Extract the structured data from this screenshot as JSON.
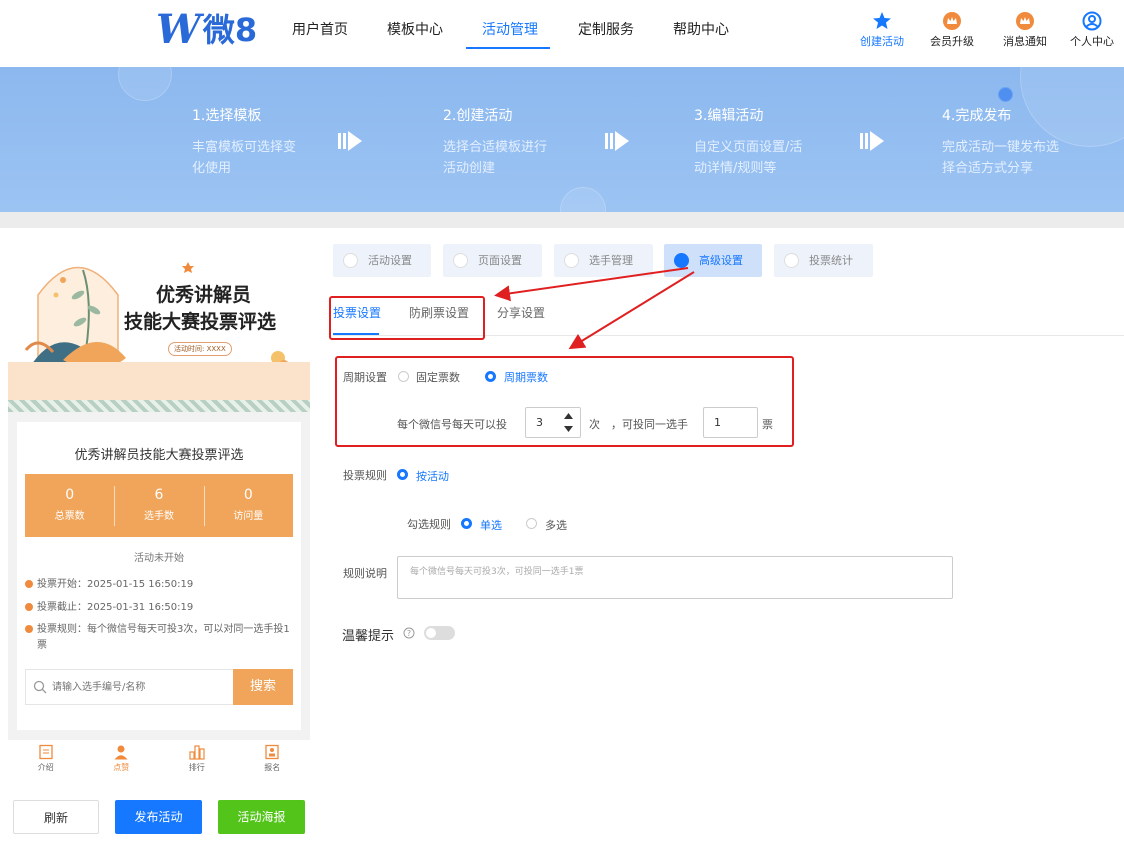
{
  "header": {
    "logo_letter": "W",
    "logo_text": "微8",
    "nav": [
      "用户首页",
      "模板中心",
      "活动管理",
      "定制服务",
      "帮助中心"
    ],
    "active_nav": "活动管理",
    "icons": [
      {
        "label": "创建活动",
        "icon": "star-icon"
      },
      {
        "label": "会员升级",
        "icon": "crown-icon"
      },
      {
        "label": "消息通知",
        "icon": "bell-icon"
      },
      {
        "label": "个人中心",
        "icon": "user-circle-icon"
      }
    ]
  },
  "steps": [
    {
      "title": "1.选择模板",
      "desc": "丰富模板可选择变化使用"
    },
    {
      "title": "2.创建活动",
      "desc": "选择合适模板进行活动创建"
    },
    {
      "title": "3.编辑活动",
      "desc": "自定义页面设置/活动详情/规则等"
    },
    {
      "title": "4.完成发布",
      "desc": "完成活动一键发布选择合适方式分享"
    }
  ],
  "preview": {
    "poster_title_1": "优秀讲解员",
    "poster_title_2": "技能大赛投票评选",
    "poster_time": "活动时间: XXXX",
    "card_title": "优秀讲解员技能大赛投票评选",
    "stats": [
      {
        "value": "0",
        "label": "总票数"
      },
      {
        "value": "6",
        "label": "选手数"
      },
      {
        "value": "0",
        "label": "访问量"
      }
    ],
    "status": "活动未开始",
    "info": [
      "投票开始：2025-01-15 16:50:19",
      "投票截止：2025-01-31 16:50:19",
      "投票规则：每个微信号每天可投3次，可以对同一选手投1票"
    ],
    "search_placeholder": "请输入选手编号/名称",
    "search_button": "搜索",
    "tabs": [
      {
        "label": "介绍",
        "icon": "document-icon"
      },
      {
        "label": "点赞",
        "icon": "person-icon"
      },
      {
        "label": "排行",
        "icon": "ranking-icon"
      },
      {
        "label": "报名",
        "icon": "signup-icon"
      }
    ]
  },
  "buttons": {
    "refresh": "刷新",
    "publish": "发布活动",
    "poster": "活动海报"
  },
  "settings": {
    "top_tabs": [
      "活动设置",
      "页面设置",
      "选手管理",
      "高级设置",
      "投票统计"
    ],
    "active_top_tab": "高级设置",
    "sub_tabs": [
      "投票设置",
      "防刷票设置",
      "分享设置"
    ],
    "active_sub_tab": "投票设置",
    "period": {
      "label": "周期设置",
      "options": [
        "固定票数",
        "周期票数"
      ],
      "selected": "周期票数"
    },
    "per_day_prefix": "每个微信号每天可以投",
    "per_day_value": "3",
    "per_day_unit": "次",
    "same_player_prefix": "，可投同一选手",
    "same_player_value": "1",
    "same_player_unit": "票",
    "vote_rule": {
      "label": "投票规则",
      "option": "按活动"
    },
    "check_rule": {
      "label": "勾选规则",
      "options": [
        "单选",
        "多选"
      ],
      "selected": "单选"
    },
    "rule_desc": {
      "label": "规则说明",
      "placeholder": "每个微信号每天可投3次，可投同一选手1票"
    },
    "tip": {
      "label": "温馨提示",
      "enabled": false
    }
  },
  "colors": {
    "accent": "#1677ff",
    "orange": "#f0a55a",
    "green": "#52c41a",
    "annotation": "#e02020"
  }
}
